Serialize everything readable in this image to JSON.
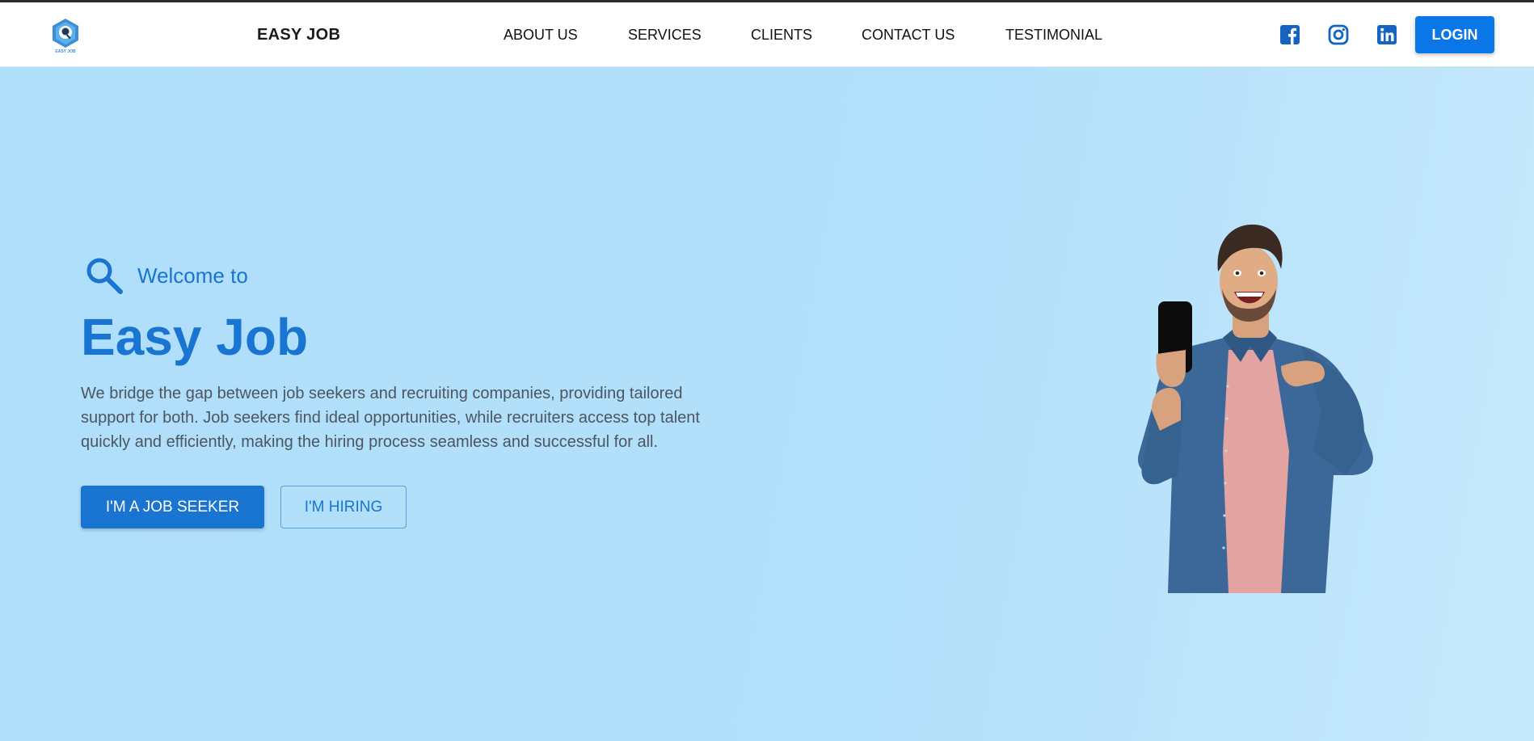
{
  "header": {
    "brand": "EASY JOB",
    "logo_text": "EASY JOB",
    "nav": [
      {
        "label": "ABOUT US"
      },
      {
        "label": "SERVICES"
      },
      {
        "label": "CLIENTS"
      },
      {
        "label": "CONTACT US"
      },
      {
        "label": "TESTIMONIAL"
      }
    ],
    "social": [
      {
        "icon": "facebook-icon"
      },
      {
        "icon": "instagram-icon"
      },
      {
        "icon": "linkedin-icon"
      }
    ],
    "login_label": "LOGIN"
  },
  "hero": {
    "welcome": "Welcome to",
    "title": "Easy Job",
    "description": "We bridge the gap between job seekers and recruiting companies, providing tailored support for both. Job seekers find ideal opportunities, while recruiters access top talent quickly and efficiently, making the hiring process seamless and successful for all.",
    "primary_cta": "I'M A JOB SEEKER",
    "secondary_cta": "I'M HIRING"
  },
  "colors": {
    "accent": "#1a74d1",
    "login": "#0a76e8",
    "hero_background": "#b3e0fb",
    "icon_blue": "#1565c0"
  }
}
